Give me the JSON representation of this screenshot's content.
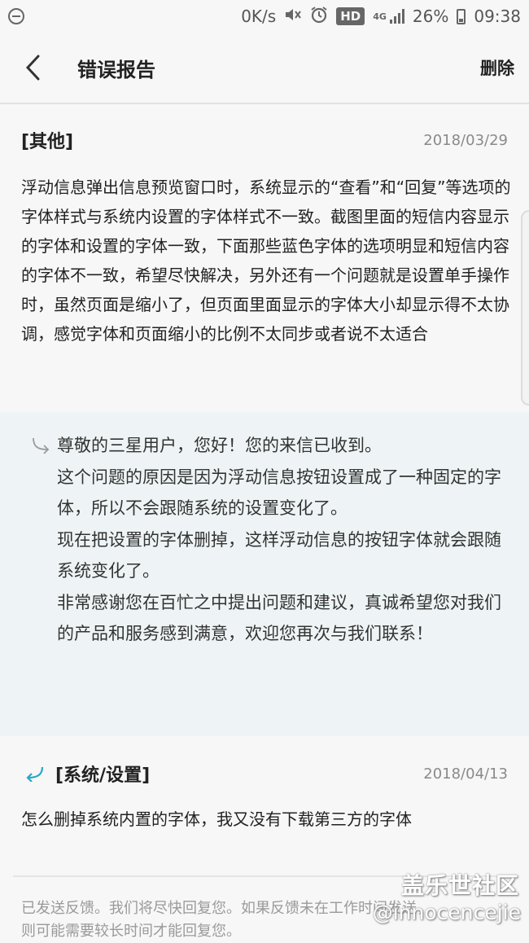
{
  "status_bar": {
    "speed": "0K/s",
    "hd": "HD",
    "network": "4G",
    "battery": "26%",
    "time": "09:38",
    "icons": [
      "do-not-disturb-icon",
      "mute-icon",
      "alarm-icon",
      "signal-icon",
      "battery-icon"
    ]
  },
  "header": {
    "title": "错误报告",
    "delete_label": "删除",
    "back_icon": "chevron-left-icon"
  },
  "reports": [
    {
      "category": "[其他]",
      "date": "2018/03/29",
      "body": "浮动信息弹出信息预览窗口时，系统显示的“查看”和“回复”等选项的字体样式与系统内设置的字体样式不一致。截图里面的短信内容显示的字体和设置的字体一致，下面那些蓝色字体的选项明显和短信内容的字体不一致，希望尽快解决，另外还有一个问题就是设置单手操作时，虽然页面是缩小了，但页面里面显示的字体大小却显示得不太协调，感觉字体和页面缩小的比例不太同步或者说不太适合"
    },
    {
      "category": "[系统/设置]",
      "date": "2018/04/13",
      "body": "怎么删掉系统内置的字体，我又没有下载第三方的字体"
    }
  ],
  "reply": {
    "paragraphs": [
      "尊敬的三星用户，您好！您的来信已收到。",
      "这个问题的原因是因为浮动信息按钮设置成了一种固定的字体，所以不会跟随系统的设置变化了。",
      "现在把设置的字体删掉，这样浮动信息的按钮字体就会跟随系统变化了。",
      "非常感谢您在百忙之中提出问题和建议，真诚希望您对我们的产品和服务感到满意，欢迎您再次与我们联系！"
    ]
  },
  "footer": {
    "line1": "已发送反馈。我们将尽快回复您。如果反馈未在工作时间发送，",
    "line2": "则可能需要较长时间才能回复您。"
  },
  "watermark": {
    "site": "盖乐世社区",
    "user": "@innocencejie"
  },
  "colors": {
    "reply_background": "#eef4f5",
    "accent_arrow": "#2aa7c9",
    "date_gray": "#8a8a8a"
  }
}
